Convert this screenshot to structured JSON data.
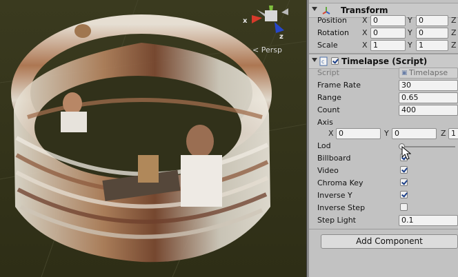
{
  "scene": {
    "persp_label": "Persp",
    "gizmo": {
      "x_label": "x",
      "z_label": "z"
    }
  },
  "transform": {
    "title": "Transform",
    "rows": [
      {
        "label": "Position",
        "x": "0",
        "y": "0",
        "z": ""
      },
      {
        "label": "Rotation",
        "x": "0",
        "y": "0",
        "z": ""
      },
      {
        "label": "Scale",
        "x": "1",
        "y": "1",
        "z": ""
      }
    ],
    "axis_labels": {
      "x": "X",
      "y": "Y",
      "z": "Z"
    }
  },
  "timelapse": {
    "title": "Timelapse (Script)",
    "script_label": "Script",
    "script_value": "Timelapse",
    "frame_rate": {
      "label": "Frame Rate",
      "value": "30"
    },
    "range": {
      "label": "Range",
      "value": "0.65"
    },
    "count": {
      "label": "Count",
      "value": "400"
    },
    "axis": {
      "label": "Axis",
      "x": "0",
      "y": "0",
      "z": "1"
    },
    "lod": {
      "label": "Lod",
      "level": 0.0
    },
    "billboard": {
      "label": "Billboard",
      "checked": true
    },
    "video": {
      "label": "Video",
      "checked": true
    },
    "chroma_key": {
      "label": "Chroma Key",
      "checked": true
    },
    "inverse_y": {
      "label": "Inverse Y",
      "checked": true
    },
    "inverse_step": {
      "label": "Inverse Step",
      "checked": false
    },
    "step_light": {
      "label": "Step Light",
      "value": "0.1"
    }
  },
  "add_component_label": "Add Component",
  "colors": {
    "scene_bg": "#323218",
    "inspector_bg": "#c2c2c2"
  }
}
